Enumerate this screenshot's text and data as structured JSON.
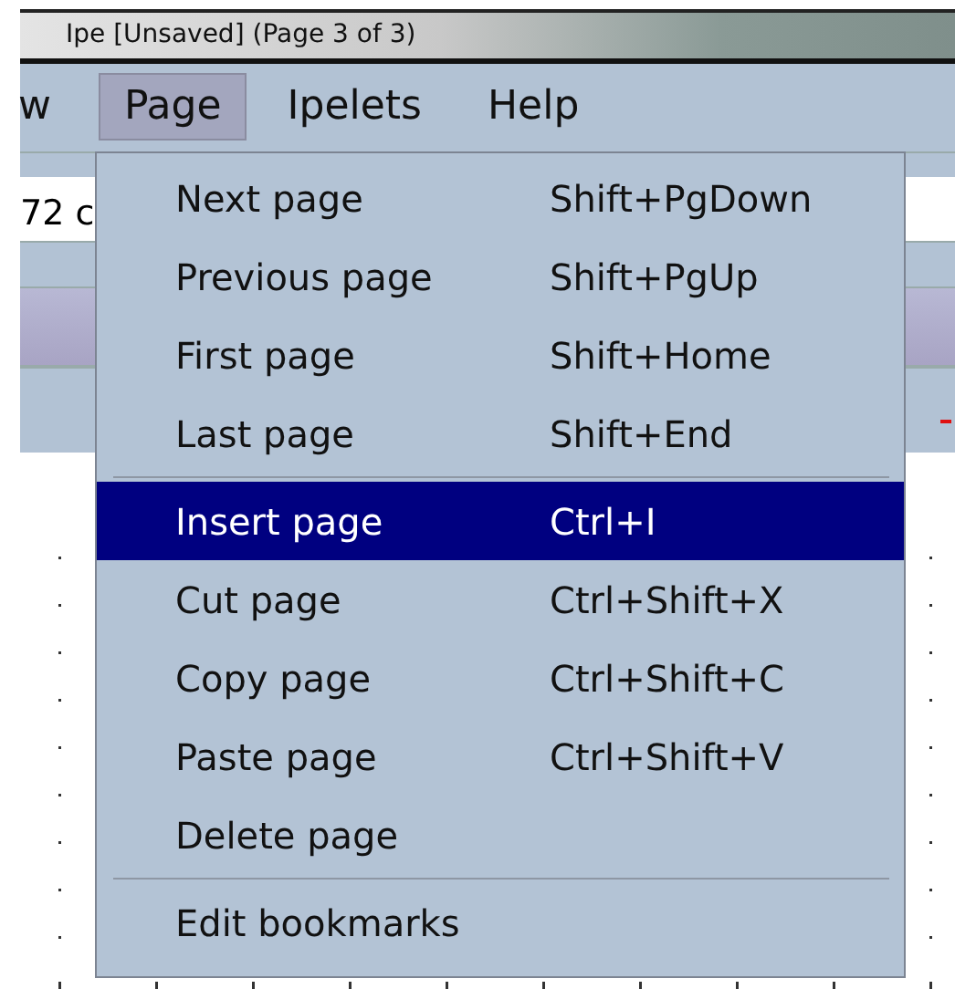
{
  "window": {
    "title": "Ipe [Unsaved] (Page 3 of 3)"
  },
  "menubar": [
    {
      "label": "w",
      "selected": false
    },
    {
      "label": "Page",
      "selected": true
    },
    {
      "label": "Ipelets",
      "selected": false
    },
    {
      "label": "Help",
      "selected": false
    }
  ],
  "toolbar": {
    "field": {
      "value": "72 c"
    }
  },
  "menu": {
    "items": [
      {
        "kind": "item",
        "label": "Next page",
        "shortcut": "Shift+PgDown",
        "selected": false
      },
      {
        "kind": "item",
        "label": "Previous page",
        "shortcut": "Shift+PgUp",
        "selected": false
      },
      {
        "kind": "item",
        "label": "First page",
        "shortcut": "Shift+Home",
        "selected": false
      },
      {
        "kind": "item",
        "label": "Last page",
        "shortcut": "Shift+End",
        "selected": false
      },
      {
        "kind": "separator"
      },
      {
        "kind": "item",
        "label": "Insert page",
        "shortcut": "Ctrl+I",
        "selected": true
      },
      {
        "kind": "item",
        "label": "Cut page",
        "shortcut": "Ctrl+Shift+X",
        "selected": false
      },
      {
        "kind": "item",
        "label": "Copy page",
        "shortcut": "Ctrl+Shift+C",
        "selected": false
      },
      {
        "kind": "item",
        "label": "Paste page",
        "shortcut": "Ctrl+Shift+V",
        "selected": false
      },
      {
        "kind": "item",
        "label": "Delete page",
        "selected": false
      },
      {
        "kind": "separator"
      },
      {
        "kind": "item",
        "label": "Edit bookmarks",
        "selected": false
      }
    ]
  }
}
